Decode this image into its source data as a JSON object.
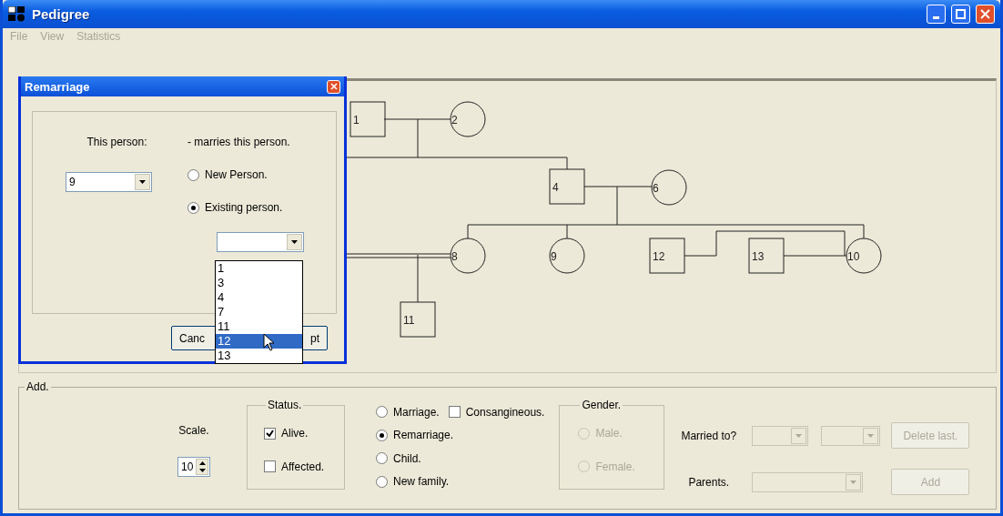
{
  "window": {
    "title": "Pedigree"
  },
  "menu": [
    {
      "label": "File",
      "disabled": true
    },
    {
      "label": "View",
      "disabled": true
    },
    {
      "label": "Statistics",
      "disabled": true
    }
  ],
  "pedigree": {
    "members": [
      {
        "label": "1",
        "kind": "square"
      },
      {
        "label": "2",
        "kind": "circle"
      },
      {
        "label": "4",
        "kind": "square"
      },
      {
        "label": "6",
        "kind": "circle"
      },
      {
        "label": "8",
        "kind": "circle"
      },
      {
        "label": "9",
        "kind": "circle"
      },
      {
        "label": "12",
        "kind": "square"
      },
      {
        "label": "13",
        "kind": "square"
      },
      {
        "label": "10",
        "kind": "circle"
      },
      {
        "label": "11",
        "kind": "square"
      }
    ]
  },
  "dialog": {
    "title": "Remarriage",
    "this_person_label": "This person:",
    "this_person_value": "9",
    "marries_label": "- marries this person.",
    "options": [
      {
        "label": "New Person.",
        "selected": false
      },
      {
        "label": "Existing person.",
        "selected": true
      }
    ],
    "existing_list": [
      {
        "label": "1",
        "selected": false
      },
      {
        "label": "3",
        "selected": false
      },
      {
        "label": "4",
        "selected": false
      },
      {
        "label": "7",
        "selected": false
      },
      {
        "label": "11",
        "selected": false
      },
      {
        "label": "12",
        "selected": true
      },
      {
        "label": "13",
        "selected": false
      }
    ],
    "buttons": [
      "Canc",
      "pt"
    ]
  },
  "add_panel": {
    "title": "Add.",
    "scale_label": "Scale.",
    "scale_value": "10",
    "status": {
      "title": "Status.",
      "checks": [
        {
          "label": "Alive.",
          "checked": true
        },
        {
          "label": "Affected.",
          "checked": false
        }
      ]
    },
    "actions": [
      {
        "label": "Marriage.",
        "selected": false
      },
      {
        "label": "Remarriage.",
        "selected": true
      },
      {
        "label": "Child.",
        "selected": false
      },
      {
        "label": "New family.",
        "selected": false
      }
    ],
    "consanguineous": {
      "label": "Consangineous.",
      "checked": false
    },
    "gender": {
      "title": "Gender.",
      "options": [
        {
          "label": "Male.",
          "selected": false,
          "disabled": true
        },
        {
          "label": "Female.",
          "selected": false,
          "disabled": true
        }
      ]
    },
    "married_to": {
      "label": "Married to?",
      "disabled": true
    },
    "parents": {
      "label": "Parents.",
      "disabled": true
    },
    "buttons": [
      {
        "label": "Delete last.",
        "disabled": true
      },
      {
        "label": "Add",
        "disabled": true
      }
    ]
  }
}
